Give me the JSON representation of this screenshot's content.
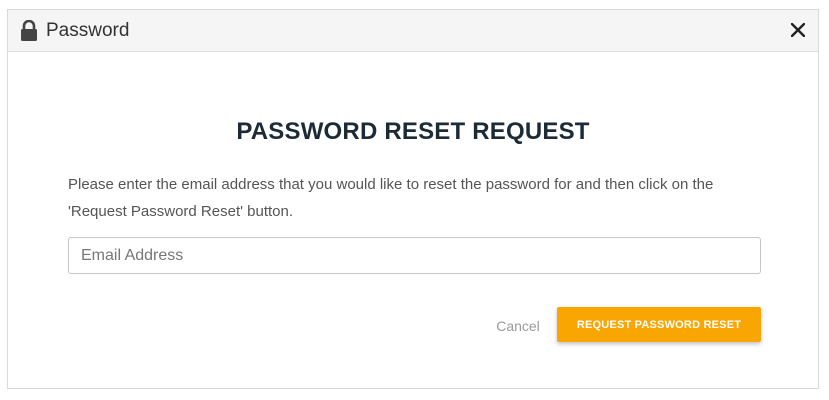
{
  "dialog": {
    "title": "Password",
    "heading": "PASSWORD RESET REQUEST",
    "instructions": "Please enter the email address that you would like to reset the password for and then click on the 'Request Password Reset' button.",
    "email_placeholder": "Email Address",
    "email_value": "",
    "cancel_label": "Cancel",
    "submit_label": "REQUEST PASSWORD RESET"
  },
  "icons": {
    "title_icon": "lock-icon",
    "close_icon": "close-icon"
  },
  "colors": {
    "accent": "#f9a602",
    "heading": "#1c2b36",
    "titlebar_bg": "#f5f5f5"
  }
}
